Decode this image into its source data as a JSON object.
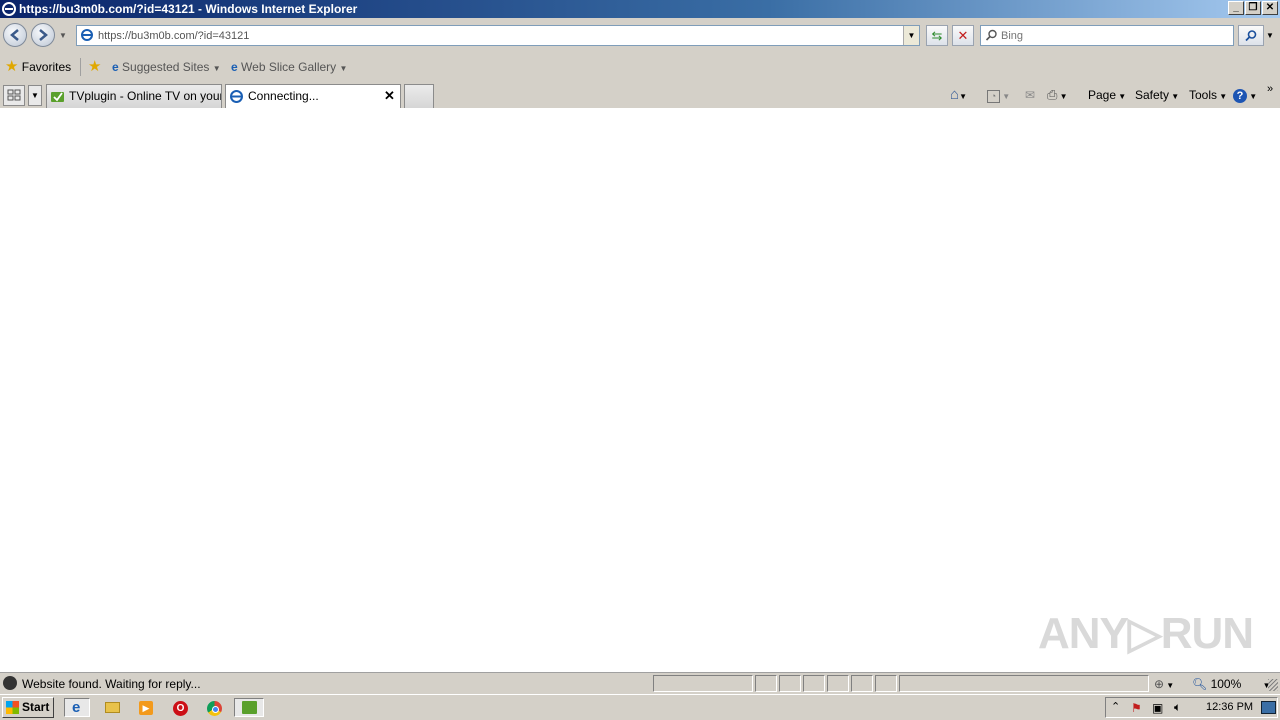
{
  "window": {
    "title": "https://bu3m0b.com/?id=43121 - Windows Internet Explorer",
    "minimize": "_",
    "restore": "❐",
    "close": "✕"
  },
  "nav": {
    "address": "https://bu3m0b.com/?id=43121",
    "search_placeholder": "Bing"
  },
  "favorites": {
    "favorites_label": "Favorites",
    "suggested_sites": "Suggested Sites",
    "web_slice_gallery": "Web Slice Gallery"
  },
  "tabs": [
    {
      "label": "TVplugin - Online TV on your ..."
    },
    {
      "label": "Connecting..."
    }
  ],
  "commands": {
    "page": "Page",
    "safety": "Safety",
    "tools": "Tools"
  },
  "status": {
    "text": "Website found. Waiting for reply...",
    "zoom": "100%"
  },
  "taskbar": {
    "start_label": "Start",
    "clock": "12:36 PM"
  },
  "watermark": "ANY▷RUN"
}
